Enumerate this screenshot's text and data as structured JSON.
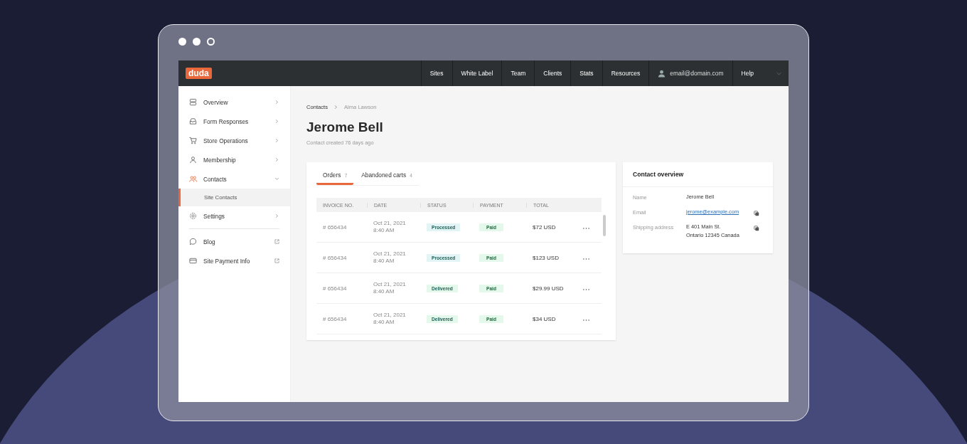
{
  "topbar": {
    "logo": "duda",
    "items": [
      {
        "label": "Sites",
        "kind": "link"
      },
      {
        "label": "White Label",
        "kind": "link"
      },
      {
        "label": "Team",
        "kind": "link"
      },
      {
        "label": "Clients",
        "kind": "link"
      },
      {
        "label": "Stats",
        "kind": "link"
      },
      {
        "label": "Resources",
        "kind": "link"
      },
      {
        "label": "email@domain.com",
        "kind": "account"
      },
      {
        "label": "Help",
        "kind": "menu"
      }
    ]
  },
  "sidebar": {
    "sections": [
      [
        {
          "label": "Overview",
          "kind": "chevron",
          "selected": false
        },
        {
          "label": "Form Responses",
          "kind": "chevron",
          "selected": false
        },
        {
          "label": "Store Operations",
          "kind": "chevron",
          "selected": false
        },
        {
          "label": "Membership",
          "kind": "chevron",
          "selected": false
        },
        {
          "label": "Contacts",
          "kind": "chevron",
          "selected": true,
          "expanded": true,
          "children": [
            {
              "label": "Site Contacts",
              "selected": true
            }
          ]
        },
        {
          "label": "Settings",
          "kind": "chevron",
          "selected": false
        }
      ],
      [
        {
          "label": "Blog",
          "kind": "external",
          "selected": false
        },
        {
          "label": "Site Payment Info",
          "kind": "external",
          "selected": false
        }
      ]
    ]
  },
  "breadcrumb": [
    "Contacts",
    "Alma Lawson"
  ],
  "title": "Jerome Bell",
  "subtitle": "Contact created 76 days ago",
  "tabs": [
    {
      "label": "Orders",
      "count": "7",
      "selected": true
    },
    {
      "label": "Abandoned carts",
      "count": "4",
      "selected": false
    }
  ],
  "table": {
    "columns": [
      "INVOICE NO.",
      "DATE",
      "STATUS",
      "PAYMENT",
      "TOTAL"
    ],
    "rows": [
      {
        "invoice": "# 656434",
        "date": "Oct 21, 2021",
        "time": "8:40 AM",
        "status": {
          "label": "Processed",
          "color": "#e2f4f6"
        },
        "payment": "Paid",
        "total": "$72 USD"
      },
      {
        "invoice": "# 656434",
        "date": "Oct 21, 2021",
        "time": "8:40 AM",
        "status": {
          "label": "Processed",
          "color": "#e2f4f6"
        },
        "payment": "Paid",
        "total": "$123 USD"
      },
      {
        "invoice": "# 656434",
        "date": "Oct 21, 2021",
        "time": "8:40 AM",
        "status": {
          "label": "Delivered",
          "color": "#e4f8ec"
        },
        "payment": "Paid",
        "total": "$29.99 USD"
      },
      {
        "invoice": "# 656434",
        "date": "Oct 21, 2021",
        "time": "8:40 AM",
        "status": {
          "label": "Delivered",
          "color": "#e4f8ec"
        },
        "payment": "Paid",
        "total": "$34 USD"
      }
    ]
  },
  "overview": {
    "title": "Contact overview",
    "fields": [
      {
        "label": "Name",
        "value": [
          "Jerome Bell"
        ],
        "kind": "text"
      },
      {
        "label": "Email",
        "value": [
          "jerome@example.com"
        ],
        "kind": "link"
      },
      {
        "label": "Shipping address",
        "value": [
          "E 401 Main St.",
          "Ontario 12345 Canada"
        ],
        "kind": "copy"
      }
    ]
  }
}
